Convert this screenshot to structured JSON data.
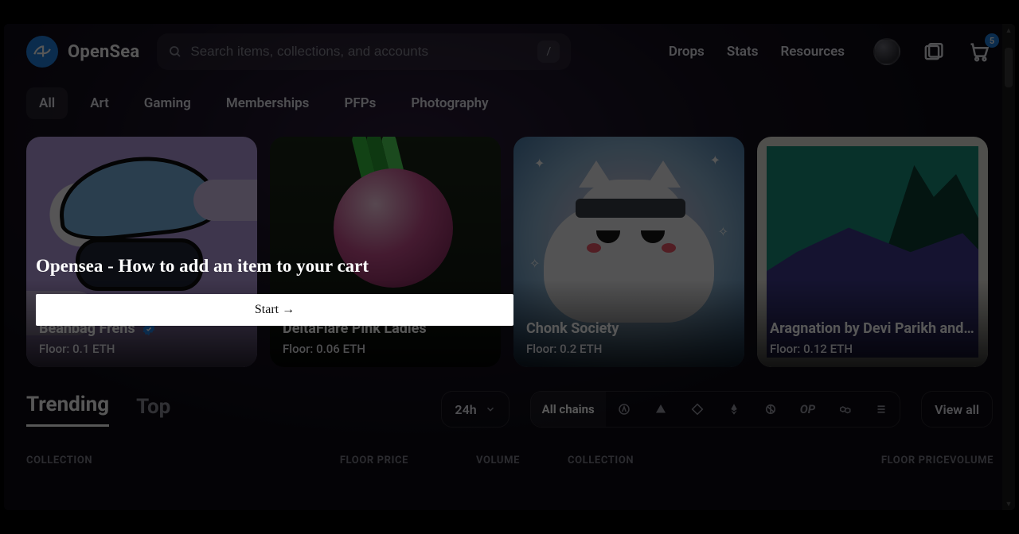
{
  "brand": {
    "name": "OpenSea"
  },
  "search": {
    "placeholder": "Search items, collections, and accounts",
    "shortcut": "/"
  },
  "nav": {
    "drops": "Drops",
    "stats": "Stats",
    "resources": "Resources"
  },
  "cart": {
    "count": "5"
  },
  "categories": [
    "All",
    "Art",
    "Gaming",
    "Memberships",
    "PFPs",
    "Photography"
  ],
  "cards": [
    {
      "title": "Beanbag Frens",
      "floor": "Floor: 0.1 ETH",
      "verified": true
    },
    {
      "title": "DeltaFlare Pink Ladies",
      "floor": "Floor: 0.06 ETH",
      "verified": false
    },
    {
      "title": "Chonk Society",
      "floor": "Floor: 0.2 ETH",
      "verified": false
    },
    {
      "title": "Aragnation by Devi Parikh and…",
      "floor": "Floor: 0.12 ETH",
      "verified": false
    }
  ],
  "tt": {
    "trending": "Trending",
    "top": "Top"
  },
  "timeframe": "24h",
  "chains_label": "All chains",
  "chain_op": "OP",
  "view_all": "View all",
  "thead": {
    "collection": "COLLECTION",
    "floor": "FLOOR PRICE",
    "volume": "VOLUME"
  },
  "tutorial": {
    "title": "Opensea - How to add an item to your cart",
    "start": "Start →"
  }
}
